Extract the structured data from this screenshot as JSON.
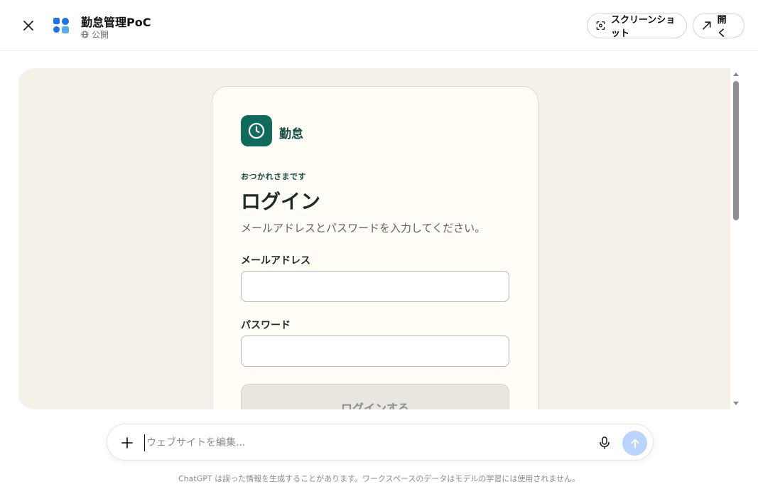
{
  "header": {
    "app_title": "勤怠管理PoC",
    "visibility": "公開",
    "screenshot_label": "スクリーンショット",
    "open_label": "開く"
  },
  "preview": {
    "brand_name": "勤怠",
    "eyebrow": "おつかれさまです",
    "title": "ログイン",
    "subtitle": "メールアドレスとパスワードを入力してください。",
    "email_label": "メールアドレス",
    "email_value": "",
    "password_label": "パスワード",
    "password_value": "",
    "login_button": "ログインする"
  },
  "composer": {
    "placeholder": "ウェブサイトを編集...",
    "disclaimer": "ChatGPT は誤った情報を生成することがあります。ワークスペースのデータはモデルの学習には使用されません。"
  },
  "colors": {
    "brand_green": "#0f6b5c",
    "preview_bg": "#f5f1e8",
    "send_button": "#bcd4fb"
  },
  "icons": {
    "close": "close-icon",
    "app_logo": "app-grid-icon",
    "globe": "globe-icon",
    "screenshot": "screenshot-icon",
    "open": "arrow-up-right-icon",
    "clock": "clock-icon",
    "plus": "plus-icon",
    "mic": "mic-icon",
    "send": "arrow-up-icon"
  }
}
